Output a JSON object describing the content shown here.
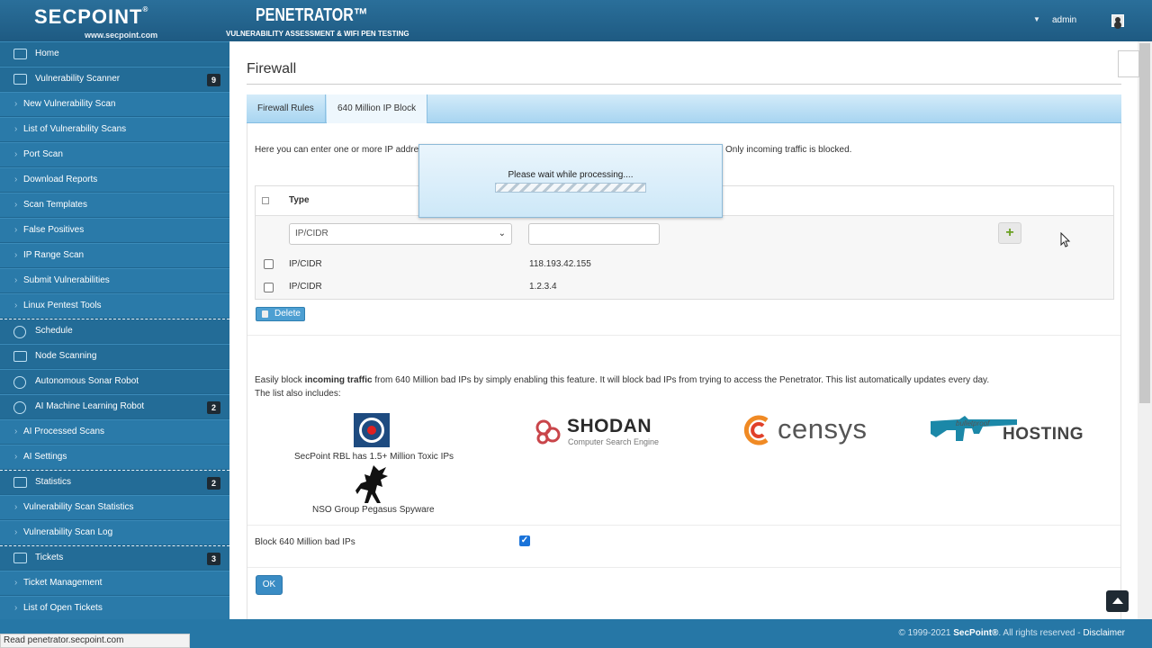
{
  "header": {
    "logo_text": "SECPOINT",
    "logo_mark": "®",
    "logo_url": "www.secpoint.com",
    "product": "PENETRATOR™",
    "product_tagline": "VULNERABILITY ASSESSMENT & WIFI PEN TESTING",
    "user": "admin"
  },
  "sidebar": {
    "items": [
      {
        "label": "Home"
      },
      {
        "label": "Vulnerability Scanner",
        "badge": "9"
      },
      {
        "label": "New Vulnerability Scan"
      },
      {
        "label": "List of Vulnerability Scans"
      },
      {
        "label": "Port Scan"
      },
      {
        "label": "Download Reports"
      },
      {
        "label": "Scan Templates"
      },
      {
        "label": "False Positives"
      },
      {
        "label": "IP Range Scan"
      },
      {
        "label": "Submit Vulnerabilities"
      },
      {
        "label": "Linux Pentest Tools"
      },
      {
        "label": "Schedule"
      },
      {
        "label": "Node Scanning"
      },
      {
        "label": "Autonomous Sonar Robot"
      },
      {
        "label": "AI Machine Learning Robot",
        "badge": "2"
      },
      {
        "label": "AI Processed Scans"
      },
      {
        "label": "AI Settings"
      },
      {
        "label": "Statistics",
        "badge": "2"
      },
      {
        "label": "Vulnerability Scan Statistics"
      },
      {
        "label": "Vulnerability Scan Log"
      },
      {
        "label": "Tickets",
        "badge": "3"
      },
      {
        "label": "Ticket Management"
      },
      {
        "label": "List of Open Tickets"
      }
    ]
  },
  "main": {
    "title": "Firewall",
    "tabs": [
      {
        "label": "Firewall Rules"
      },
      {
        "label": "640 Million IP Block"
      }
    ],
    "description_left": "Here you can enter one or more IP addres",
    "description_right": "Only incoming traffic is blocked.",
    "table": {
      "header_type": "Type",
      "select_value": "IP/CIDR",
      "rows": [
        {
          "type": "IP/CIDR",
          "value": "118.193.42.155"
        },
        {
          "type": "IP/CIDR",
          "value": "1.2.3.4"
        }
      ]
    },
    "delete_label": "Delete",
    "info_prefix": "Easily block ",
    "info_bold": "incoming traffic",
    "info_suffix": " from 640 Million bad IPs by simply enabling this feature. It will block bad IPs from trying to access the Penetrator. This list automatically updates every day.",
    "info_line2": "The list also includes:",
    "sources": {
      "secpoint_caption": "SecPoint RBL has 1.5+ Million Toxic IPs",
      "pegasus_caption": "NSO Group Pegasus Spyware",
      "shodan_word": "SHODAN",
      "shodan_sub": "Computer Search Engine",
      "censys_word": "censys",
      "bulletproof_word": "bulletproof",
      "hosting_word": "HOSTING"
    },
    "block_label": "Block 640 Million bad IPs",
    "block_checked": true,
    "ok_label": "OK"
  },
  "modal": {
    "text": "Please wait while processing...."
  },
  "footer": {
    "copyright": "© 1999-2021 ",
    "brand": "SecPoint®",
    "rights": ". All rights reserved - ",
    "disclaimer": "Disclaimer"
  },
  "status_bar": "Read penetrator.secpoint.com",
  "colors": {
    "header": "#1e5a82",
    "sidebar": "#2677a6",
    "accent": "#3a8cc4",
    "badge": "#1e2a33"
  }
}
